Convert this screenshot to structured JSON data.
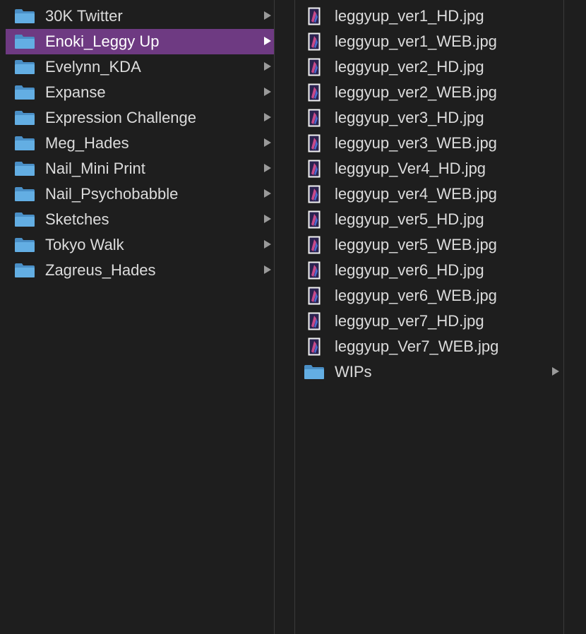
{
  "column1": {
    "items": [
      {
        "label": "30K Twitter",
        "selected": false
      },
      {
        "label": "Enoki_Leggy Up",
        "selected": true
      },
      {
        "label": "Evelynn_KDA",
        "selected": false
      },
      {
        "label": "Expanse",
        "selected": false
      },
      {
        "label": "Expression Challenge",
        "selected": false
      },
      {
        "label": "Meg_Hades",
        "selected": false
      },
      {
        "label": "Nail_Mini Print",
        "selected": false
      },
      {
        "label": "Nail_Psychobabble",
        "selected": false
      },
      {
        "label": "Sketches",
        "selected": false
      },
      {
        "label": "Tokyo Walk",
        "selected": false
      },
      {
        "label": "Zagreus_Hades",
        "selected": false
      }
    ]
  },
  "column2": {
    "files": [
      {
        "label": "leggyup_ver1_HD.jpg"
      },
      {
        "label": "leggyup_ver1_WEB.jpg"
      },
      {
        "label": "leggyup_ver2_HD.jpg"
      },
      {
        "label": "leggyup_ver2_WEB.jpg"
      },
      {
        "label": "leggyup_ver3_HD.jpg"
      },
      {
        "label": "leggyup_ver3_WEB.jpg"
      },
      {
        "label": "leggyup_Ver4_HD.jpg"
      },
      {
        "label": "leggyup_ver4_WEB.jpg"
      },
      {
        "label": "leggyup_ver5_HD.jpg"
      },
      {
        "label": "leggyup_ver5_WEB.jpg"
      },
      {
        "label": "leggyup_ver6_HD.jpg"
      },
      {
        "label": "leggyup_ver6_WEB.jpg"
      },
      {
        "label": "leggyup_ver7_HD.jpg"
      },
      {
        "label": "leggyup_Ver7_WEB.jpg"
      }
    ],
    "folders": [
      {
        "label": "WIPs"
      }
    ]
  },
  "colors": {
    "background": "#1e1e1e",
    "selection": "#6e3a82",
    "text": "#dcdcdc",
    "folder": "#5aa5dc",
    "divider": "#3a3a3a"
  },
  "icons": {
    "folder": "folder-icon",
    "image_file": "image-file-icon",
    "disclosure": "chevron-right-icon"
  }
}
